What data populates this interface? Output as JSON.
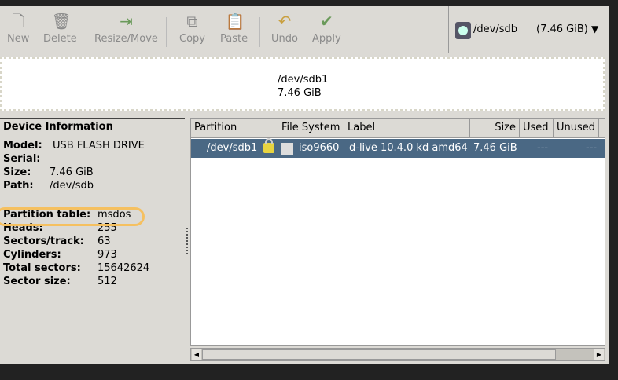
{
  "toolbar": {
    "buttons": [
      {
        "label": "New",
        "icon": "new-file-icon"
      },
      {
        "label": "Delete",
        "icon": "trash-icon"
      },
      {
        "label": "Resize/Move",
        "icon": "resize-arrow-icon"
      },
      {
        "label": "Copy",
        "icon": "copy-icon"
      },
      {
        "label": "Paste",
        "icon": "paste-icon"
      },
      {
        "label": "Undo",
        "icon": "undo-icon"
      },
      {
        "label": "Apply",
        "icon": "checkmark-icon"
      }
    ]
  },
  "device_selector": {
    "device": "/dev/sdb",
    "size": "(7.46 GiB)",
    "icon": "drive-icon"
  },
  "graph": {
    "partition": "/dev/sdb1",
    "size": "7.46 GiB"
  },
  "device_info": {
    "title": "Device Information",
    "fields": [
      {
        "label": "Model:",
        "value": "USB FLASH DRIVE"
      },
      {
        "label": "Serial:",
        "value": ""
      },
      {
        "label": "Size:",
        "value": "7.46 GiB"
      },
      {
        "label": "Path:",
        "value": "/dev/sdb"
      },
      {
        "label": "Partition table:",
        "value": "msdos"
      },
      {
        "label": "Heads:",
        "value": "255"
      },
      {
        "label": "Sectors/track:",
        "value": "63"
      },
      {
        "label": "Cylinders:",
        "value": "973"
      },
      {
        "label": "Total sectors:",
        "value": "15642624"
      },
      {
        "label": "Sector size:",
        "value": "512"
      }
    ]
  },
  "partitions": {
    "columns": [
      "Partition",
      "File System",
      "Label",
      "Size",
      "Used",
      "Unused",
      ""
    ],
    "rows": [
      {
        "partition": "/dev/sdb1",
        "filesystem": "iso9660",
        "label": "d-live 10.4.0 kd amd64",
        "size": "7.46 GiB",
        "used": "---",
        "unused": "---",
        "locked": true
      }
    ]
  },
  "colors": {
    "selection": "#4a6884",
    "highlight": "#f5c060"
  }
}
